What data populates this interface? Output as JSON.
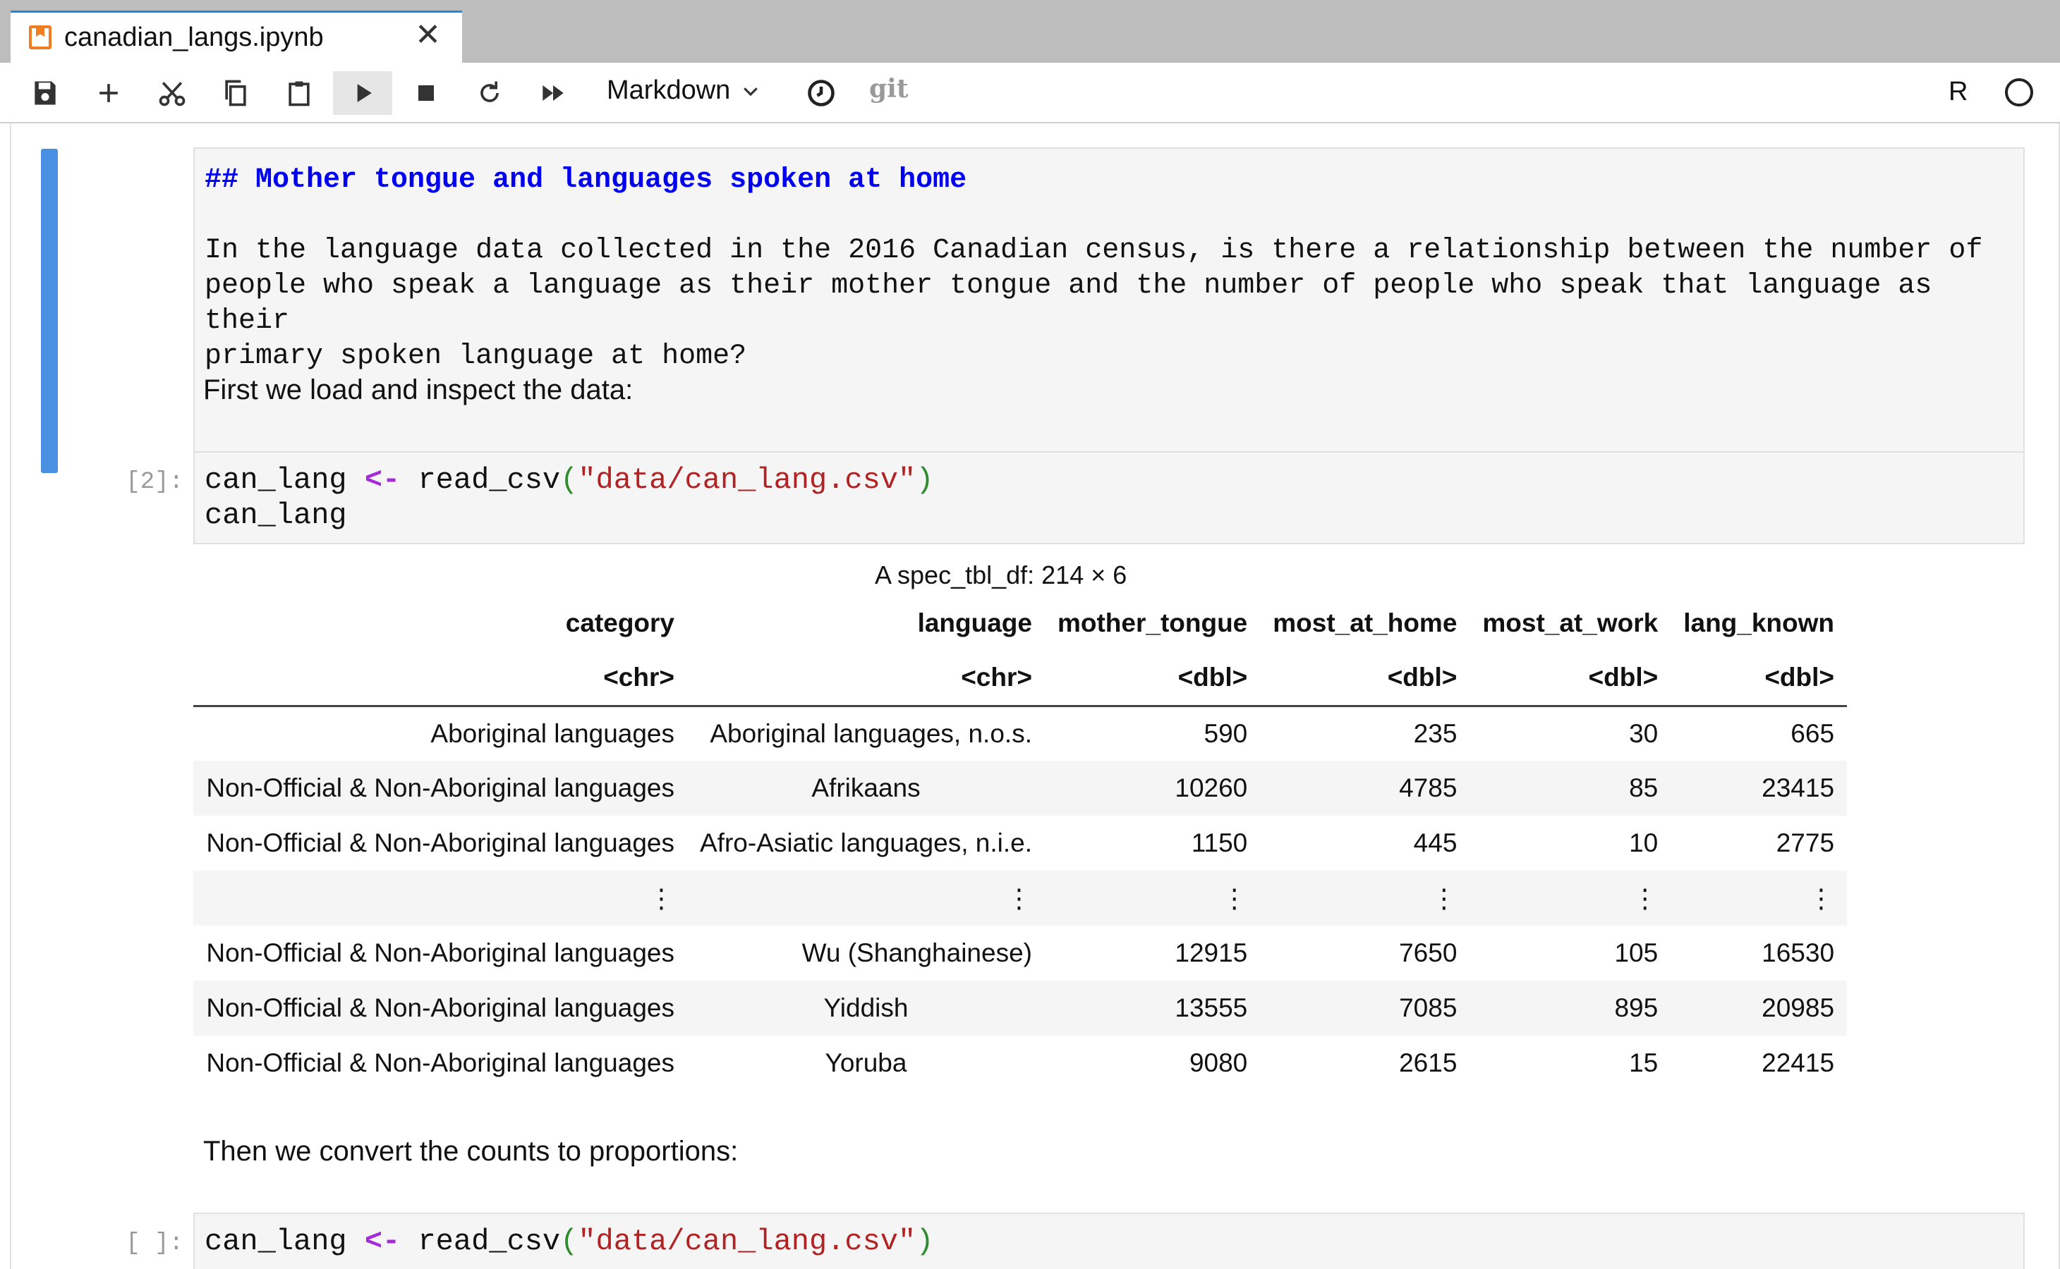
{
  "tab": {
    "title": "canadian_langs.ipynb",
    "close_glyph": "✕"
  },
  "toolbar": {
    "cell_type": "Markdown",
    "git_label": "git",
    "kernel_name": "R",
    "buttons": [
      "save-icon",
      "add-icon",
      "cut-icon",
      "copy-icon",
      "paste-icon",
      "run-icon",
      "stop-icon",
      "restart-icon",
      "fast-forward-icon",
      "clock-icon"
    ]
  },
  "cells": {
    "markdown_heading": "## Mother tongue and languages spoken at home",
    "markdown_body": "In the language data collected in the 2016 Canadian census, is there a relationship between the number of\npeople who speak a language as their mother tongue and the number of people who speak that language as their\nprimary spoken language at home?",
    "prose1": "First we load and inspect the data:",
    "prompt1": "[2]:",
    "code1_line1_a": "can_lang ",
    "code1_line1_op": "<-",
    "code1_line1_b": " read_csv",
    "code1_line1_p1": "(",
    "code1_line1_str": "\"data/can_lang.csv\"",
    "code1_line1_p2": ")",
    "code1_line2": "can_lang",
    "prose2": "Then we convert the counts to proportions:",
    "prompt2": "[ ]:",
    "code2_line1_a": "can_lang ",
    "code2_line1_op": "<-",
    "code2_line1_b": " read_csv",
    "code2_line1_p1": "(",
    "code2_line1_str": "\"data/can_lang.csv\"",
    "code2_line1_p2": ")"
  },
  "output": {
    "caption": "A spec_tbl_df: 214 × 6",
    "columns": [
      "category",
      "language",
      "mother_tongue",
      "most_at_home",
      "most_at_work",
      "lang_known"
    ],
    "types": [
      "<chr>",
      "<chr>",
      "<dbl>",
      "<dbl>",
      "<dbl>",
      "<dbl>"
    ],
    "rows": [
      [
        "Aboriginal languages",
        "Aboriginal languages, n.o.s.",
        "590",
        "235",
        "30",
        "665"
      ],
      [
        "Non-Official & Non-Aboriginal languages",
        "Afrikaans",
        "10260",
        "4785",
        "85",
        "23415"
      ],
      [
        "Non-Official & Non-Aboriginal languages",
        "Afro-Asiatic languages, n.i.e.",
        "1150",
        "445",
        "10",
        "2775"
      ],
      [
        "⋮",
        "⋮",
        "⋮",
        "⋮",
        "⋮",
        "⋮"
      ],
      [
        "Non-Official & Non-Aboriginal languages",
        "Wu (Shanghainese)",
        "12915",
        "7650",
        "105",
        "16530"
      ],
      [
        "Non-Official & Non-Aboriginal languages",
        "Yiddish",
        "13555",
        "7085",
        "895",
        "20985"
      ],
      [
        "Non-Official & Non-Aboriginal languages",
        "Yoruba",
        "9080",
        "2615",
        "15",
        "22415"
      ]
    ]
  }
}
